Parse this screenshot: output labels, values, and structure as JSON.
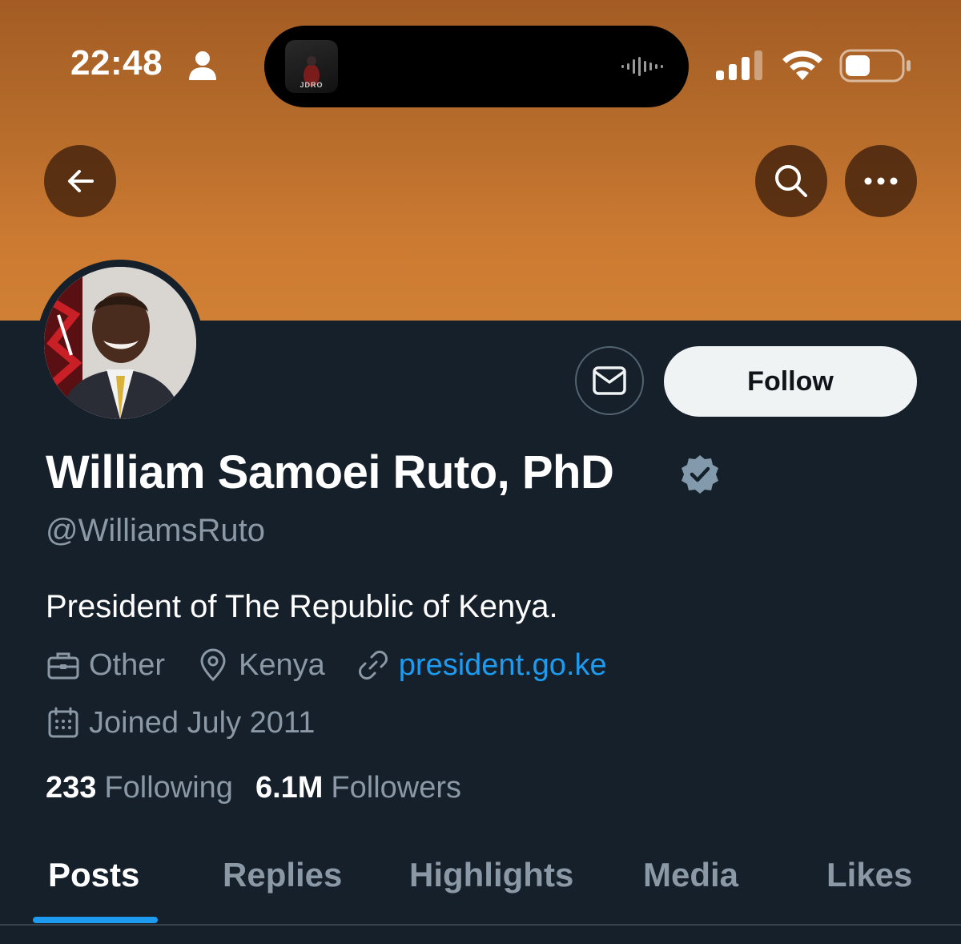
{
  "status_bar": {
    "time": "22:48"
  },
  "dynamic_island": {
    "app_label": "JDRO"
  },
  "nav": {
    "back_icon": "arrow-left-icon",
    "search_icon": "search-icon",
    "more_icon": "more-horizontal-icon"
  },
  "profile": {
    "display_name": "William Samoei Ruto, PhD",
    "handle": "@WilliamsRuto",
    "bio": "President of The Republic of Kenya.",
    "category": "Other",
    "location": "Kenya",
    "website": "president.go.ke",
    "joined": "Joined July 2011",
    "following_count": "233",
    "following_label": "Following",
    "followers_count": "6.1M",
    "followers_label": "Followers"
  },
  "actions": {
    "follow_label": "Follow",
    "message_icon": "mail-icon"
  },
  "tabs": [
    {
      "label": "Posts",
      "active": true
    },
    {
      "label": "Replies",
      "active": false
    },
    {
      "label": "Highlights",
      "active": false
    },
    {
      "label": "Media",
      "active": false
    },
    {
      "label": "Likes",
      "active": false
    }
  ],
  "colors": {
    "background": "#15202b",
    "banner": "#c4752f",
    "accent": "#1d9bf0",
    "secondary_text": "#8b98a5",
    "verified": "#829aab"
  }
}
